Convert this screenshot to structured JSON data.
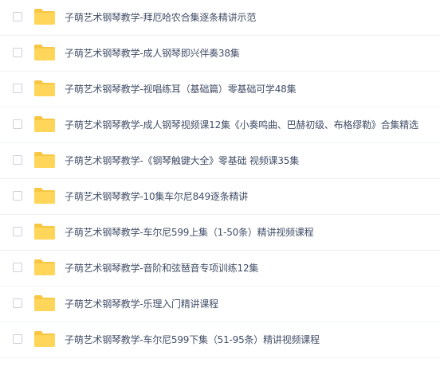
{
  "colors": {
    "folder": "#ffd659",
    "folder_tab": "#f7c744",
    "text": "#424e67",
    "divider": "#f1f2f4",
    "checkbox_border": "#cdd1d8"
  },
  "files": [
    {
      "name": "子萌艺术钢琴教学-拜厄哈农合集逐条精讲示范",
      "icon": "folder-icon",
      "checked": false
    },
    {
      "name": "子萌艺术钢琴教学-成人钢琴即兴伴奏38集",
      "icon": "folder-icon",
      "checked": false
    },
    {
      "name": "子萌艺术钢琴教学-视唱练耳（基础篇）零基础可学48集",
      "icon": "folder-icon",
      "checked": false
    },
    {
      "name": "子萌艺术钢琴教学-成人钢琴视频课12集《小奏鸣曲、巴赫初级、布格缪勒》合集精选",
      "icon": "folder-icon",
      "checked": false
    },
    {
      "name": "子萌艺术钢琴教学-《钢琴触键大全》零基础 视频课35集",
      "icon": "folder-icon",
      "checked": false
    },
    {
      "name": "子萌艺术钢琴教学-10集车尔尼849逐条精讲",
      "icon": "folder-icon",
      "checked": false
    },
    {
      "name": "子萌艺术钢琴教学-车尔尼599上集（1-50条）精讲视频课程",
      "icon": "folder-icon",
      "checked": false
    },
    {
      "name": "子萌艺术钢琴教学-音阶和弦琶音专项训练12集",
      "icon": "folder-icon",
      "checked": false
    },
    {
      "name": "子萌艺术钢琴教学-乐理入门精讲课程",
      "icon": "folder-icon",
      "checked": false
    },
    {
      "name": "子萌艺术钢琴教学-车尔尼599下集（51-95条）精讲视频课程",
      "icon": "folder-icon",
      "checked": false
    }
  ]
}
